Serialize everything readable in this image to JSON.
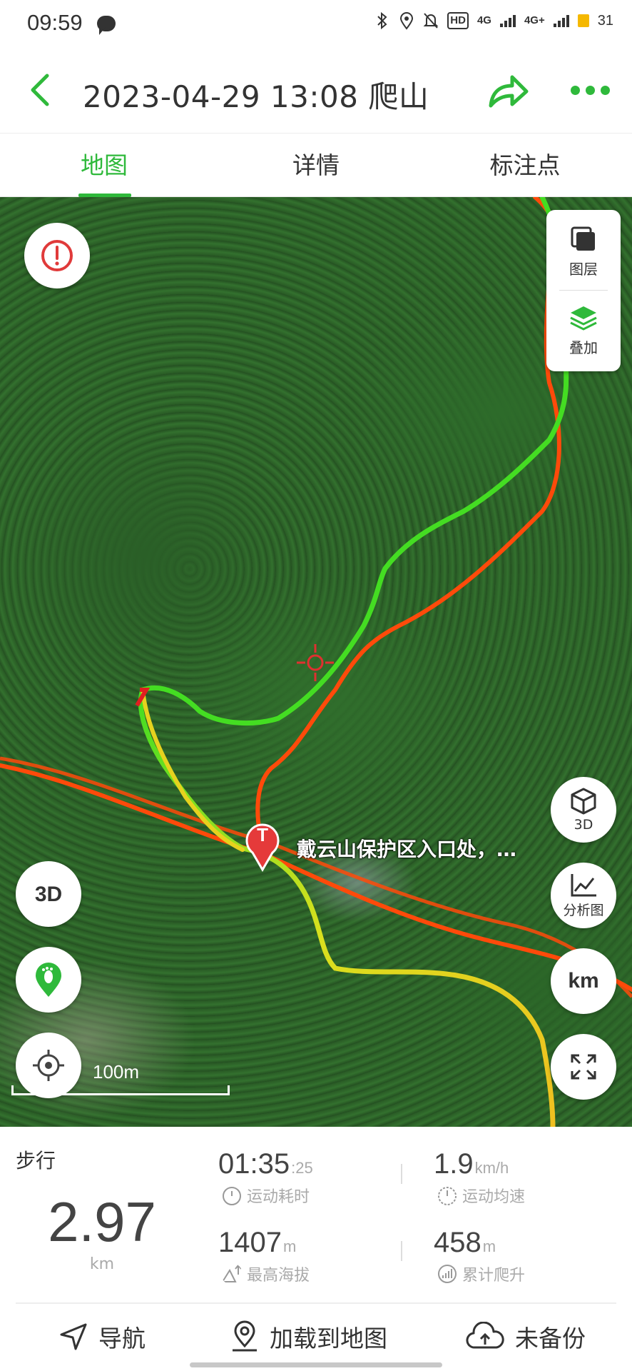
{
  "status_bar": {
    "time": "09:59",
    "hd": "HD",
    "net1": "4G",
    "net2": "4G+",
    "battery": "31"
  },
  "header": {
    "title": "2023-04-29 13:08 爬山",
    "accent_color": "#2fb93b"
  },
  "tabs": [
    {
      "label": "地图",
      "active": true
    },
    {
      "label": "详情",
      "active": false
    },
    {
      "label": "标注点",
      "active": false
    }
  ],
  "map": {
    "layer_label": "图层",
    "overlay_label": "叠加",
    "btn_3d_right": "3D",
    "analysis_label": "分析图",
    "units_label": "km",
    "poi_text": "戴云山保护区入口处，…",
    "scale_label": "100m",
    "icons": [
      "warning-icon",
      "layers-icon",
      "overlay-icon",
      "cube-3d-icon",
      "chart-icon",
      "fullscreen-icon",
      "3d-icon",
      "footprint-icon",
      "locate-icon",
      "start-marker-icon",
      "crosshair-icon"
    ],
    "track_colors": {
      "current": "#44dd22",
      "reference": "#ff4a0a",
      "slow": "#e6d21e"
    }
  },
  "stats": {
    "activity_type": "步行",
    "distance": "2.97",
    "distance_unit": "km",
    "duration": "01:35",
    "duration_sec": ":25",
    "duration_label": "运动耗时",
    "avg_speed": "1.9",
    "avg_speed_unit": "km/h",
    "avg_speed_label": "运动均速",
    "max_altitude": "1407",
    "max_altitude_unit": "m",
    "max_altitude_label": "最高海拔",
    "total_climb": "458",
    "total_climb_unit": "m",
    "total_climb_label": "累计爬升"
  },
  "bottom_bar": {
    "navigate": "导航",
    "load_to_map": "加载到地图",
    "backup": "未备份"
  }
}
